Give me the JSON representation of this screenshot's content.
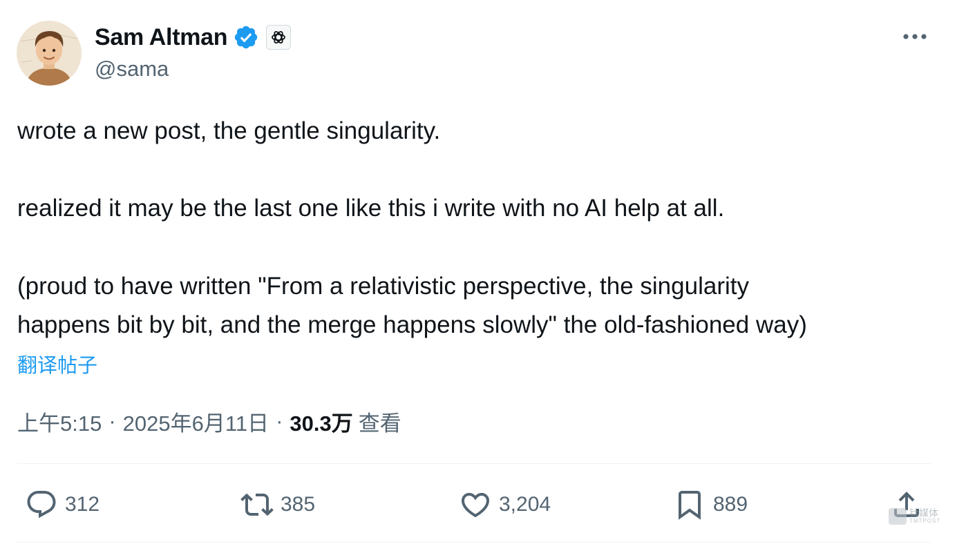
{
  "author": {
    "display_name": "Sam Altman",
    "handle": "@sama",
    "verified_icon": "verified-badge-icon",
    "affiliation_icon": "openai-logo-icon"
  },
  "tweet": {
    "lines": [
      "wrote a new post, the gentle singularity.",
      "realized it may be the last one like this i write with no AI help at all.",
      "(proud to have written \"From a relativistic perspective, the singularity",
      "happens bit by bit, and the merge happens slowly\" the old-fashioned way)"
    ],
    "translate_label": "翻译帖子"
  },
  "meta": {
    "time": "上午5:15",
    "separator": "·",
    "date": "2025年6月11日",
    "views_count": "30.3万",
    "views_label": "查看"
  },
  "actions": {
    "reply_count": "312",
    "repost_count": "385",
    "like_count": "3,204",
    "bookmark_count": "889"
  },
  "watermark": {
    "cn": "钛媒体",
    "en": "TMTPOST"
  },
  "colors": {
    "text": "#0f1419",
    "secondary": "#536471",
    "link": "#1d9bf0",
    "verified": "#1d9bf0"
  }
}
